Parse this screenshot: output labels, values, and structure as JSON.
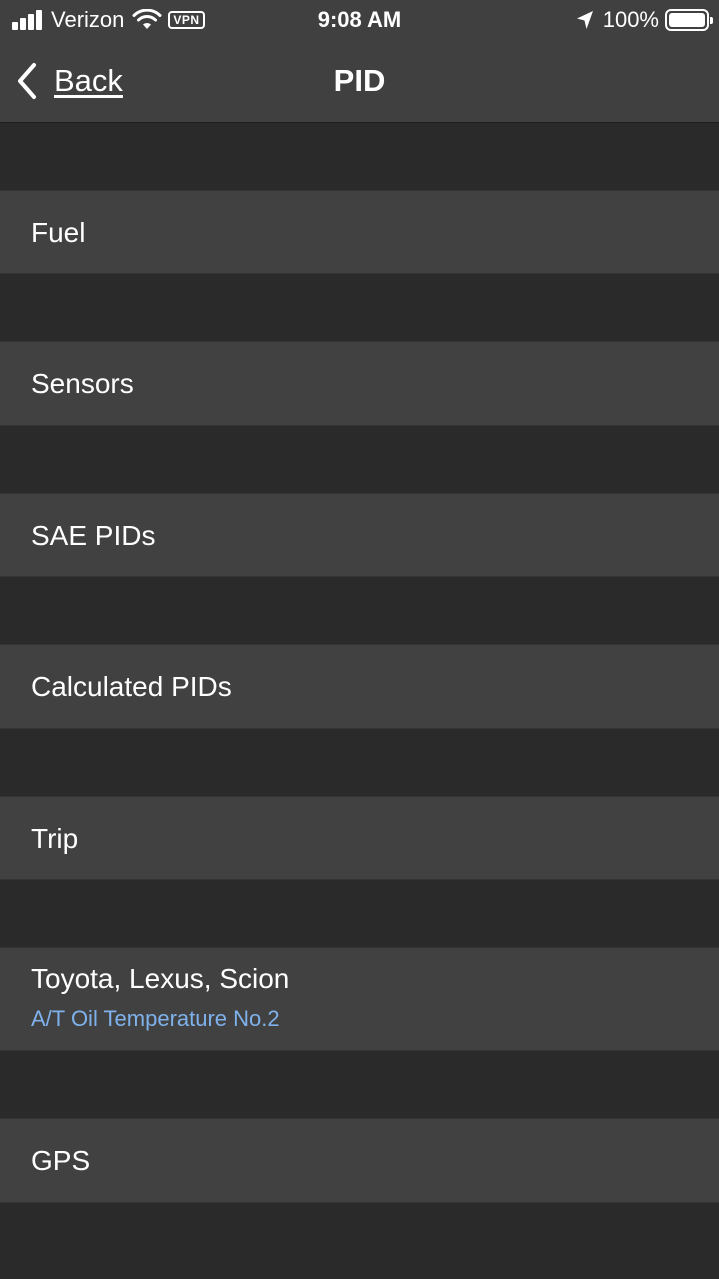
{
  "status_bar": {
    "carrier": "Verizon",
    "vpn": "VPN",
    "time": "9:08 AM",
    "battery": "100%"
  },
  "nav": {
    "back_label": "Back",
    "title": "PID"
  },
  "rows": [
    {
      "label": "Fuel"
    },
    {
      "label": "Sensors"
    },
    {
      "label": "SAE PIDs"
    },
    {
      "label": "Calculated PIDs"
    },
    {
      "label": "Trip"
    },
    {
      "label": "Toyota, Lexus, Scion",
      "subtitle": "A/T Oil Temperature No.2"
    },
    {
      "label": "GPS"
    }
  ]
}
